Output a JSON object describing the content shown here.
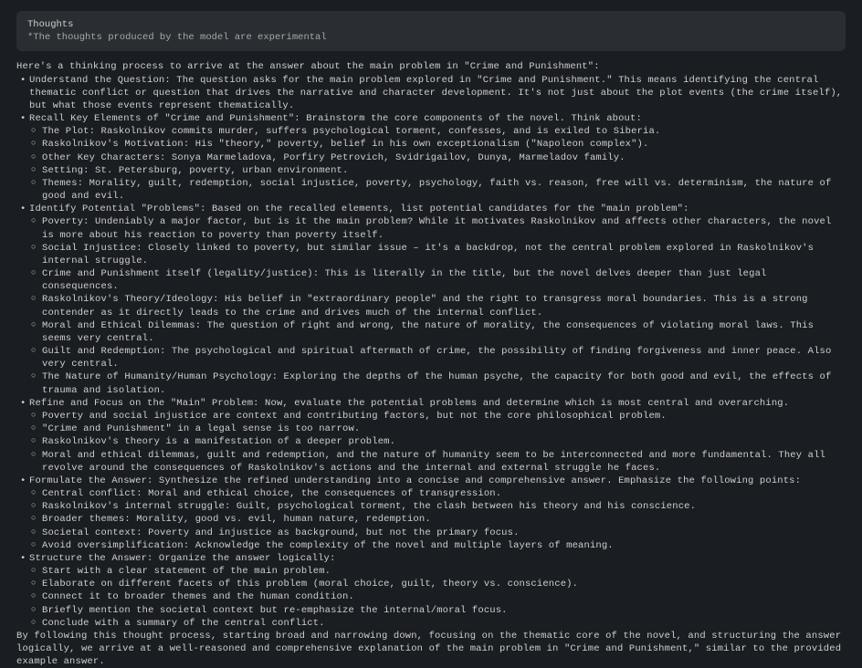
{
  "thoughts": {
    "title": "Thoughts",
    "note": "*The thoughts produced by the model are experimental"
  },
  "content": {
    "intro": "Here's a thinking process to arrive at the answer about the main problem in \"Crime and Punishment\":",
    "items": [
      {
        "text": "Understand the Question: The question asks for the main problem explored in \"Crime and Punishment.\" This means identifying the central thematic conflict or question that drives the narrative and character development. It's not just about the plot events (the crime itself), but what those events represent thematically."
      },
      {
        "text": "Recall Key Elements of \"Crime and Punishment\": Brainstorm the core components of the novel. Think about:",
        "children": [
          "The Plot: Raskolnikov commits murder, suffers psychological torment, confesses, and is exiled to Siberia.",
          "Raskolnikov's Motivation: His \"theory,\" poverty, belief in his own exceptionalism (\"Napoleon complex\").",
          "Other Key Characters: Sonya Marmeladova, Porfiry Petrovich, Svidrigailov, Dunya, Marmeladov family.",
          "Setting: St. Petersburg, poverty, urban environment.",
          "Themes: Morality, guilt, redemption, social injustice, poverty, psychology, faith vs. reason, free will vs. determinism, the nature of good and evil."
        ]
      },
      {
        "text": "Identify Potential \"Problems\": Based on the recalled elements, list potential candidates for the \"main problem\":",
        "children": [
          "Poverty: Undeniably a major factor, but is it the main problem? While it motivates Raskolnikov and affects other characters, the novel is more about his reaction to poverty than poverty itself.",
          "Social Injustice: Closely linked to poverty, but similar issue – it's a backdrop, not the central problem explored in Raskolnikov's internal struggle.",
          "Crime and Punishment itself (legality/justice): This is literally in the title, but the novel delves deeper than just legal consequences.",
          "Raskolnikov's Theory/Ideology: His belief in \"extraordinary people\" and the right to transgress moral boundaries. This is a strong contender as it directly leads to the crime and drives much of the internal conflict.",
          "Moral and Ethical Dilemmas: The question of right and wrong, the nature of morality, the consequences of violating moral laws. This seems very central.",
          "Guilt and Redemption: The psychological and spiritual aftermath of crime, the possibility of finding forgiveness and inner peace. Also very central.",
          "The Nature of Humanity/Human Psychology: Exploring the depths of the human psyche, the capacity for both good and evil, the effects of trauma and isolation."
        ]
      },
      {
        "text": "Refine and Focus on the \"Main\" Problem: Now, evaluate the potential problems and determine which is most central and overarching.",
        "children": [
          "Poverty and social injustice are context and contributing factors, but not the core philosophical problem.",
          "\"Crime and Punishment\" in a legal sense is too narrow.",
          "Raskolnikov's theory is a manifestation of a deeper problem.",
          "Moral and ethical dilemmas, guilt and redemption, and the nature of humanity seem to be interconnected and more fundamental. They all revolve around the consequences of Raskolnikov's actions and the internal and external struggle he faces."
        ]
      },
      {
        "text": "Formulate the Answer: Synthesize the refined understanding into a concise and comprehensive answer. Emphasize the following points:",
        "children": [
          "Central conflict: Moral and ethical choice, the consequences of transgression.",
          "Raskolnikov's internal struggle: Guilt, psychological torment, the clash between his theory and his conscience.",
          "Broader themes: Morality, good vs. evil, human nature, redemption.",
          "Societal context: Poverty and injustice as background, but not the primary focus.",
          "Avoid oversimplification: Acknowledge the complexity of the novel and multiple layers of meaning."
        ]
      },
      {
        "text": "Structure the Answer: Organize the answer logically:",
        "children": [
          "Start with a clear statement of the main problem.",
          "Elaborate on different facets of this problem (moral choice, guilt, theory vs. conscience).",
          "Connect it to broader themes and the human condition.",
          "Briefly mention the societal context but re-emphasize the internal/moral focus.",
          "Conclude with a summary of the central conflict."
        ]
      }
    ],
    "outro": "By following this thought process, starting broad and narrowing down, focusing on the thematic core of the novel, and structuring the answer logically, we arrive at a well-reasoned and comprehensive explanation of the main problem in \"Crime and Punishment,\" similar to the provided example answer."
  }
}
